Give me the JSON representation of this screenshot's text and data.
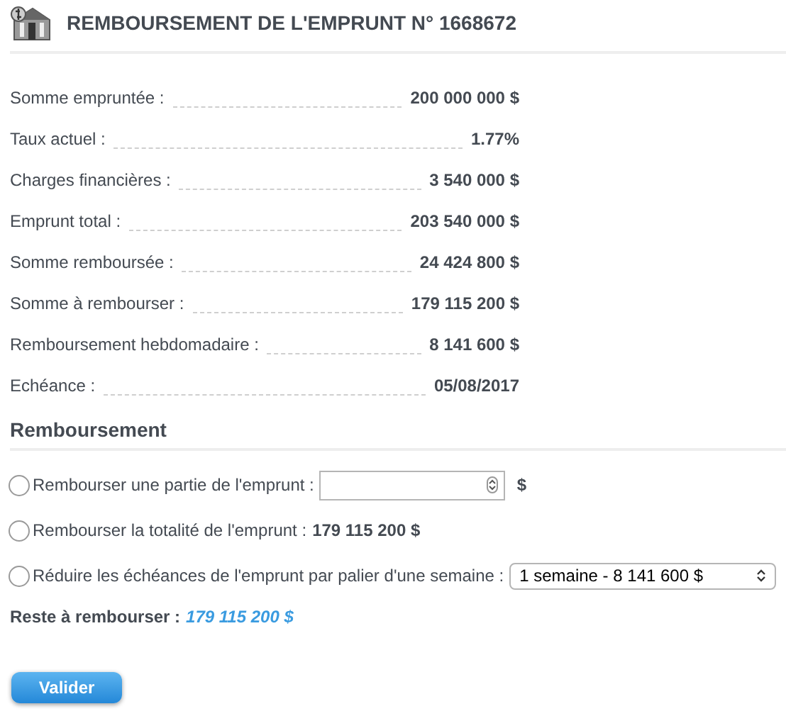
{
  "title": "REMBOURSEMENT DE L'EMPRUNT N° 1668672",
  "details": [
    {
      "label": "Somme empruntée :",
      "value": "200 000 000 $"
    },
    {
      "label": "Taux actuel :",
      "value": "1.77%"
    },
    {
      "label": "Charges financières :",
      "value": "3 540 000 $"
    },
    {
      "label": "Emprunt total :",
      "value": "203 540 000 $"
    },
    {
      "label": "Somme remboursée :",
      "value": "24 424 800 $"
    },
    {
      "label": "Somme à rembourser :",
      "value": "179 115 200 $"
    },
    {
      "label": "Remboursement hebdomadaire :",
      "value": "8 141 600 $"
    },
    {
      "label": "Echéance :",
      "value": "05/08/2017"
    }
  ],
  "section_title": "Remboursement",
  "options": [
    {
      "kind": "input",
      "label": "Rembourser une partie de l'emprunt :",
      "suffix": "$",
      "selected": false
    },
    {
      "kind": "text",
      "label": "Rembourser la totalité de l'emprunt :",
      "amount": "179 115 200 $",
      "selected": false
    },
    {
      "kind": "select",
      "label": "Réduire les échéances de l'emprunt par palier d'une semaine :",
      "value": "1 semaine - 8 141 600 $",
      "selected": false
    }
  ],
  "remaining": {
    "label": "Reste à rembourser :",
    "value": "179 115 200 $"
  },
  "submit": "Valider"
}
